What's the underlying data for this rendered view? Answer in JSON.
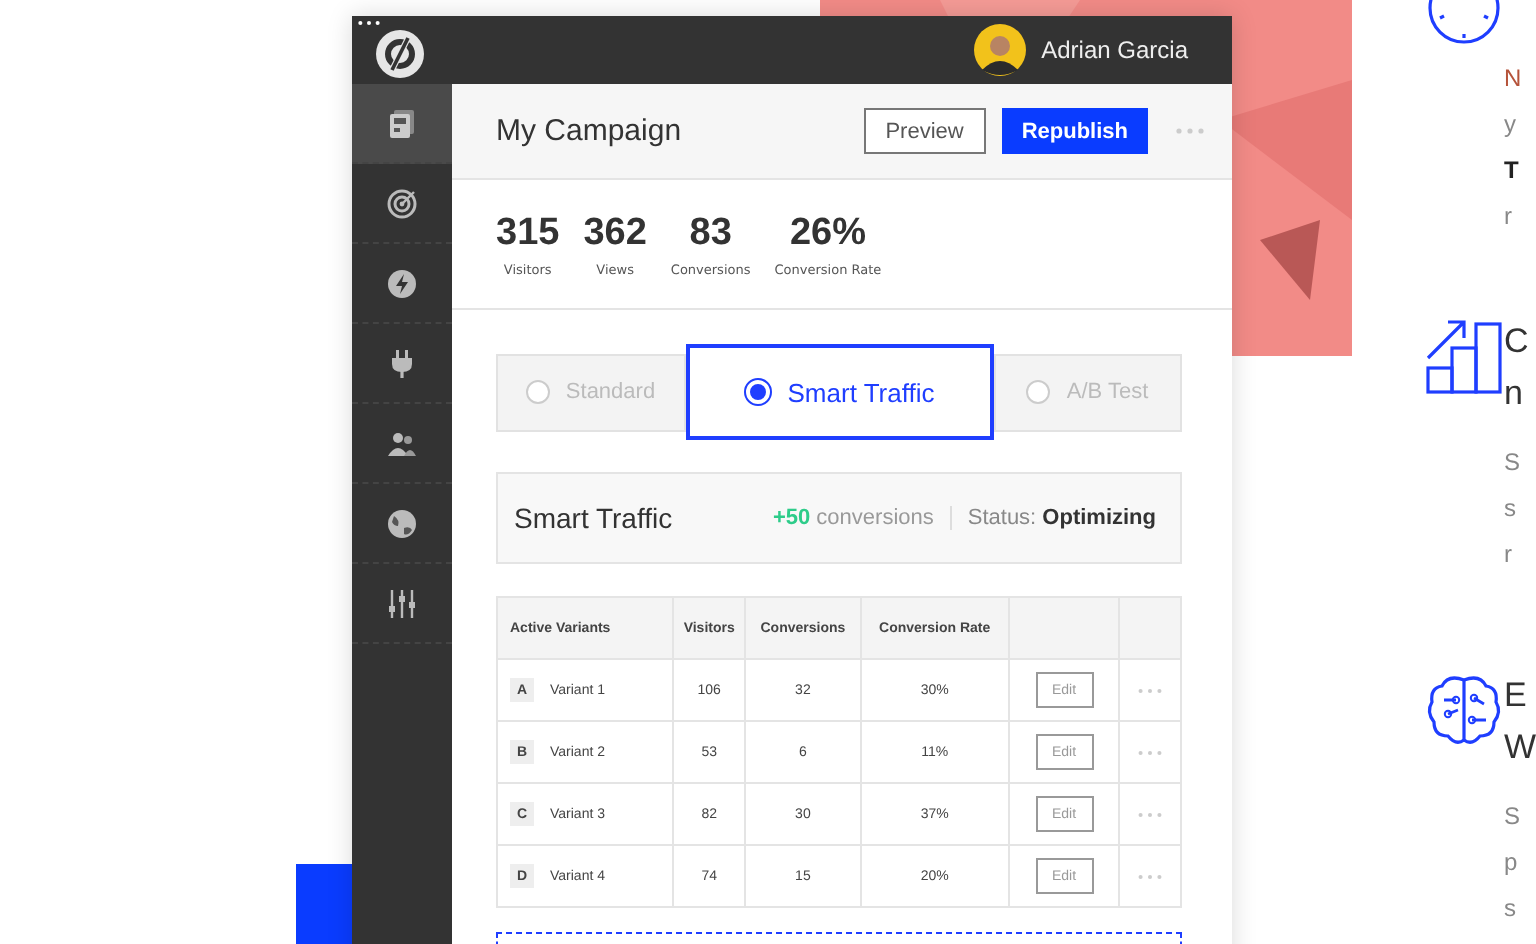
{
  "app": {
    "user": {
      "name": "Adrian Garcia"
    },
    "sidebar": {
      "items": [
        {
          "kind": "pages",
          "selected": true
        },
        {
          "kind": "target",
          "selected": false
        },
        {
          "kind": "bolt",
          "selected": false
        },
        {
          "kind": "plug",
          "selected": false
        },
        {
          "kind": "people",
          "selected": false
        },
        {
          "kind": "globe",
          "selected": false
        },
        {
          "kind": "sliders",
          "selected": false
        }
      ]
    },
    "campaign": {
      "title": "My Campaign",
      "buttons": [
        {
          "kind": "secondary",
          "label": "Preview"
        },
        {
          "kind": "primary",
          "label": "Republish"
        }
      ]
    },
    "stats": [
      {
        "value": "315",
        "label": "Visitors"
      },
      {
        "value": "362",
        "label": "Views"
      },
      {
        "value": "83",
        "label": "Conversions"
      },
      {
        "value": "26%",
        "label": "Conversion Rate"
      }
    ],
    "modes": [
      {
        "label": "Standard",
        "selected": false
      },
      {
        "label": "Smart Traffic",
        "selected": true
      },
      {
        "label": "A/B Test",
        "selected": false
      }
    ],
    "summary": {
      "title": "Smart Traffic",
      "gain": "+50",
      "gain_label": "conversions",
      "status": "Status: **Optimizing**"
    },
    "table": {
      "columns": [
        "Active Variants",
        "Visitors",
        "Conversions",
        "Conversion Rate"
      ],
      "rows": [
        {
          "letter": "A",
          "name": "Variant 1",
          "visitors": "106",
          "conversions": "32",
          "rate": "30%",
          "action": "Edit"
        },
        {
          "letter": "B",
          "name": "Variant 2",
          "visitors": "53",
          "conversions": "6",
          "rate": "11%",
          "action": "Edit"
        },
        {
          "letter": "C",
          "name": "Variant 3",
          "visitors": "82",
          "conversions": "30",
          "rate": "37%",
          "action": "Edit"
        },
        {
          "letter": "D",
          "name": "Variant 4",
          "visitors": "74",
          "conversions": "15",
          "rate": "20%",
          "action": "Edit"
        }
      ]
    }
  },
  "features": [
    {
      "kind": "clock",
      "body": [
        "N",
        "y",
        "**T**",
        "r"
      ]
    },
    {
      "kind": "chart",
      "heading": [
        "C",
        "n"
      ],
      "body": [
        "S",
        "s",
        "r"
      ]
    },
    {
      "kind": "brain",
      "heading": [
        "E",
        "W"
      ],
      "body": [
        "S",
        "p",
        "s"
      ]
    }
  ]
}
